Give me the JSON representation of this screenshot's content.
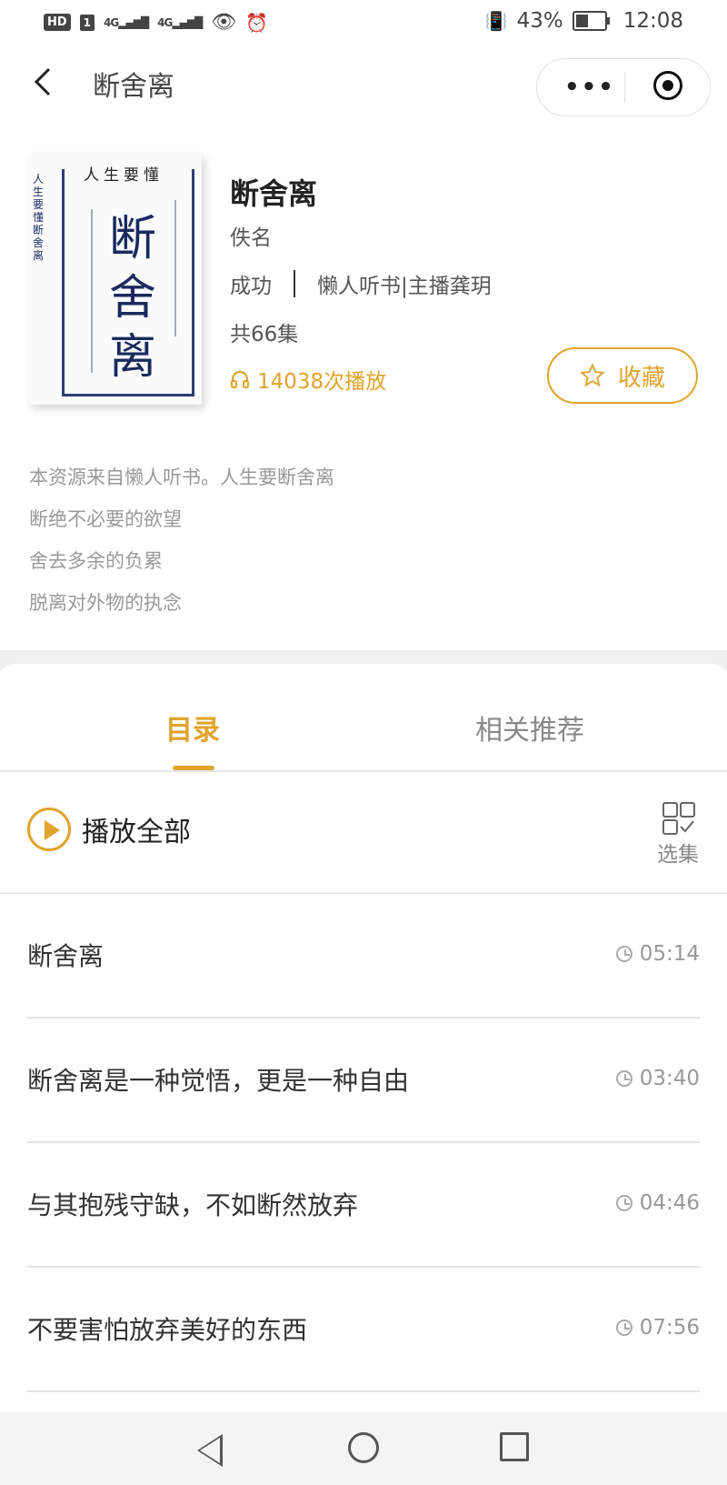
{
  "status_bar": {
    "hd": "HD",
    "sim": "1",
    "signal1": "4G",
    "signal2": "4G",
    "battery_text": "43%",
    "battery_level": 0.43,
    "time": "12:08"
  },
  "nav": {
    "title": "断舍离",
    "more_label": "•••"
  },
  "book": {
    "title": "断舍离",
    "author": "佚名",
    "category": "成功",
    "source": "懒人听书|主播龚玥",
    "episodes": "共66集",
    "plays": "14038次播放",
    "favorite_label": "收藏",
    "cover": {
      "top": "人生要懂",
      "chars": [
        "断",
        "舍",
        "离"
      ],
      "spine": "人生要懂断舍离"
    }
  },
  "description": [
    "本资源来自懒人听书。人生要断舍离",
    "断绝不必要的欲望",
    "舍去多余的负累",
    "脱离对外物的执念"
  ],
  "tabs": {
    "catalog": "目录",
    "recommend": "相关推荐"
  },
  "play_all": "播放全部",
  "select_label": "选集",
  "tracks": [
    {
      "title": "断舍离",
      "duration": "05:14"
    },
    {
      "title": "断舍离是一种觉悟，更是一种自由",
      "duration": "03:40"
    },
    {
      "title": "与其抱残守缺，不如断然放弃",
      "duration": "04:46"
    },
    {
      "title": "不要害怕放弃美好的东西",
      "duration": "07:56"
    }
  ],
  "colors": {
    "accent": "#e0a32c",
    "cover_ink": "#1a2a5e"
  }
}
